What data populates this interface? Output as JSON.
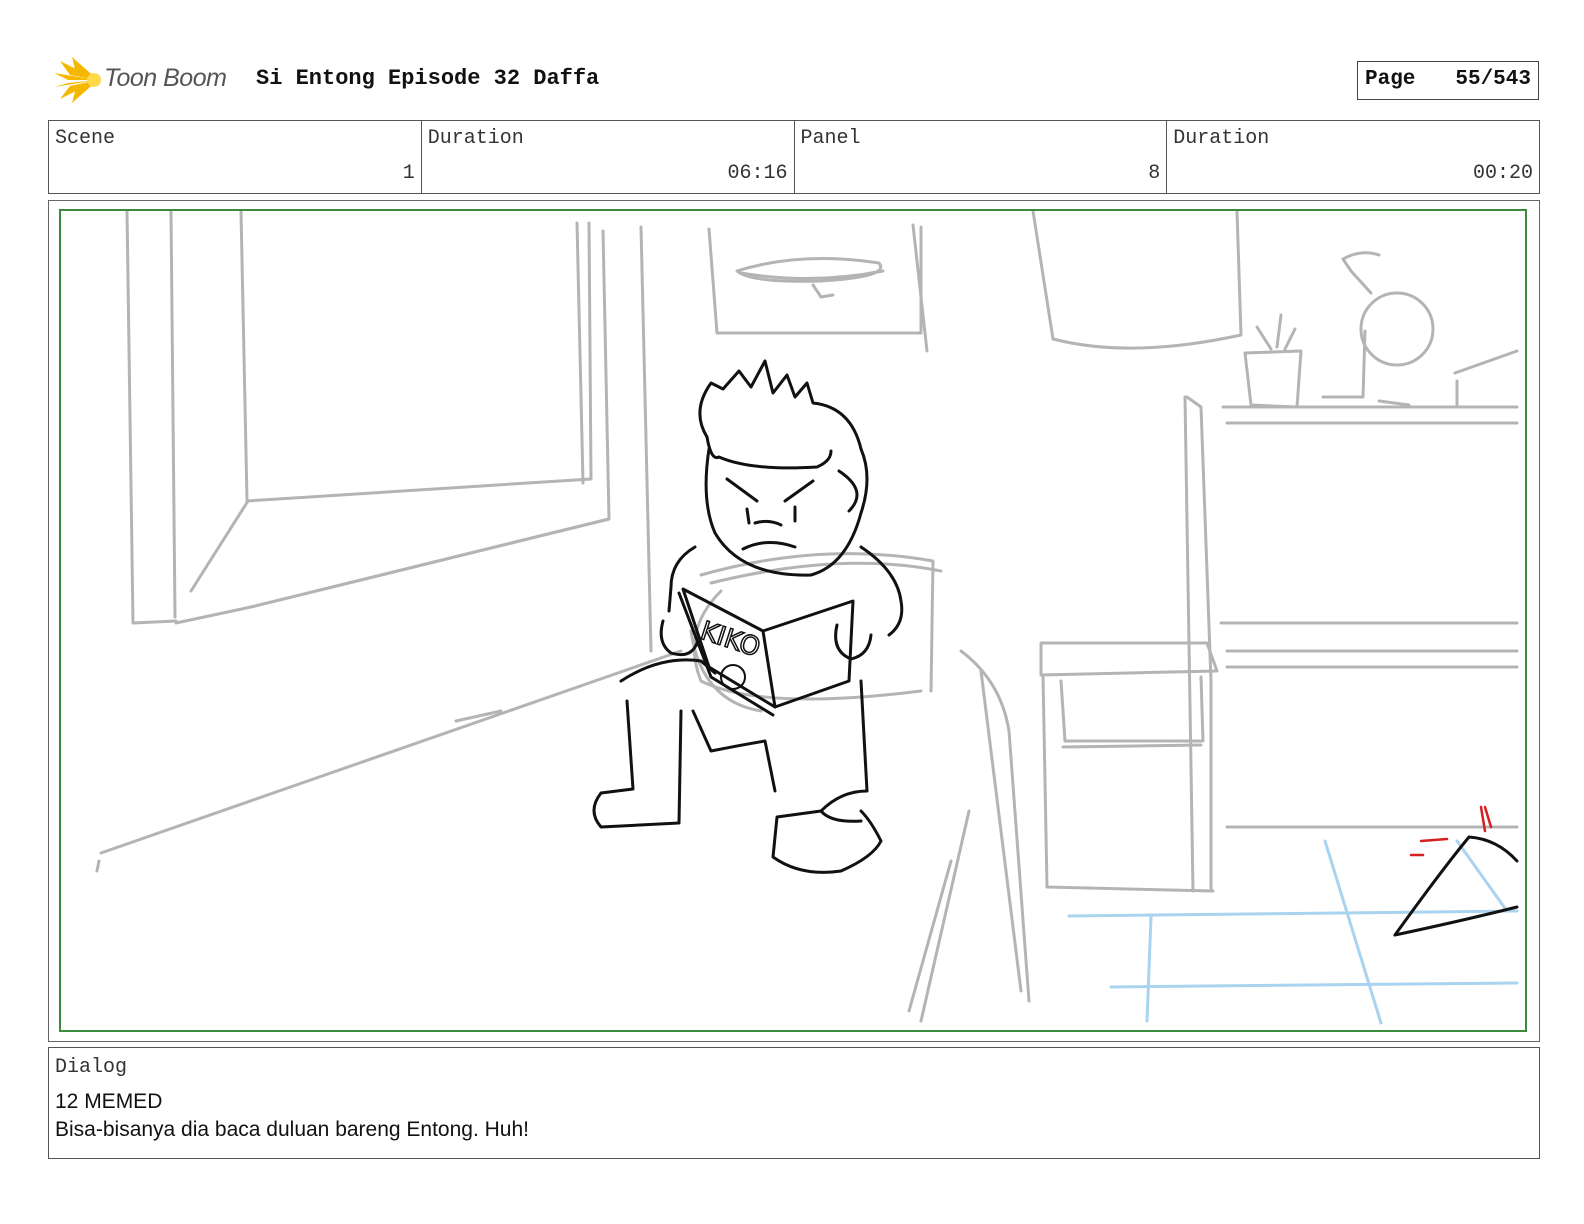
{
  "header": {
    "logo_text": "Toon Boom",
    "title": "Si Entong Episode 32 Daffa",
    "page_label": "Page",
    "page_value": "55/543"
  },
  "info": {
    "scene_label": "Scene",
    "scene_value": "1",
    "scene_duration_label": "Duration",
    "scene_duration_value": "06:16",
    "panel_label": "Panel",
    "panel_value": "8",
    "panel_duration_label": "Duration",
    "panel_duration_value": "00:20"
  },
  "sketch": {
    "book_cover_text": "KIKO",
    "colors": {
      "frame_green": "#3c8a3c",
      "pencil_gray": "#b4b4b4",
      "ink_black": "#111111",
      "floor_blue": "#a9d3ee",
      "accent_red": "#d42020"
    }
  },
  "dialog": {
    "label": "Dialog",
    "speaker": "12 MEMED",
    "line": "Bisa-bisanya dia baca duluan bareng Entong. Huh!"
  }
}
